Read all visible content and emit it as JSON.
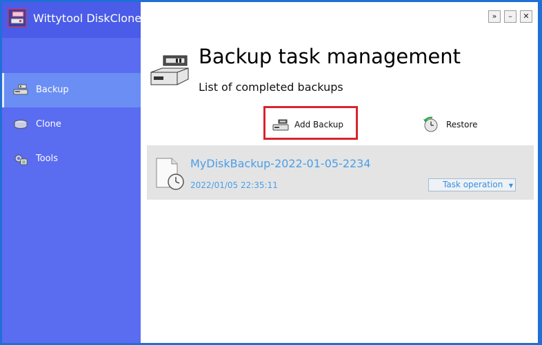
{
  "app": {
    "title": "Wittytool DiskClone"
  },
  "window_controls": {
    "expand": "»",
    "minimize": "–",
    "close": "✕"
  },
  "sidebar": {
    "items": [
      {
        "label": "Backup",
        "icon": "backup-drive-icon",
        "active": true
      },
      {
        "label": "Clone",
        "icon": "clone-disks-icon",
        "active": false
      },
      {
        "label": "Tools",
        "icon": "tools-gear-icon",
        "active": false
      }
    ]
  },
  "main": {
    "header_icon": "hard-drive-icon",
    "title": "Backup task management",
    "subtitle": "List of completed backups",
    "actions": {
      "add_backup": "Add Backup",
      "restore": "Restore"
    },
    "backups": [
      {
        "name": "MyDiskBackup-2022-01-05-2234",
        "date": "2022/01/05 22:35:11",
        "operation_label": "Task operation",
        "icon": "backup-file-clock-icon"
      }
    ]
  },
  "colors": {
    "sidebar": "#5a6cf0",
    "sidebar_active": "#6a8ef4",
    "highlight_border": "#d9232d",
    "link": "#4a9ee8",
    "row_background": "#e4e4e4"
  }
}
